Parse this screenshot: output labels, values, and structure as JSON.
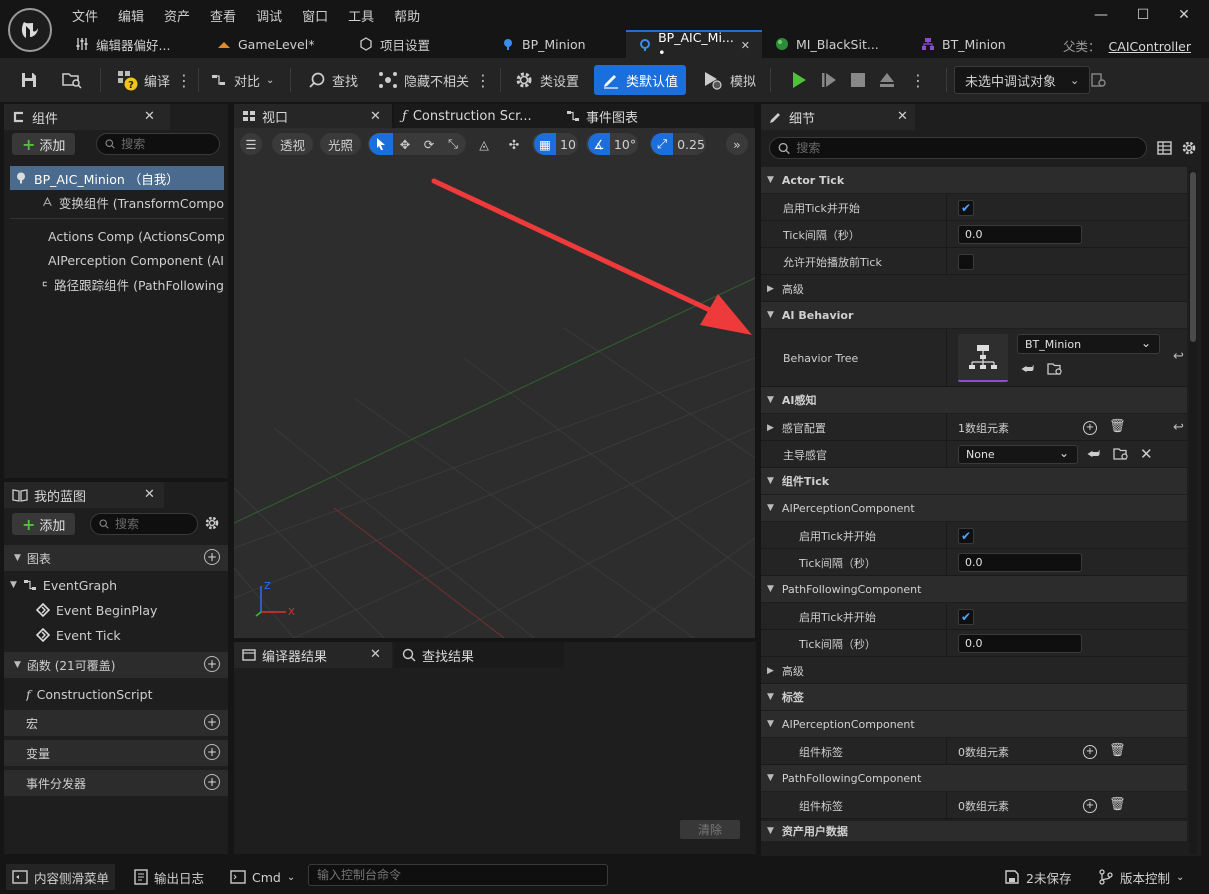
{
  "menu": [
    "文件",
    "编辑",
    "资产",
    "查看",
    "调试",
    "窗口",
    "工具",
    "帮助"
  ],
  "window_controls": {
    "minimize": "—",
    "maximize": "☐",
    "close": "✕"
  },
  "tabs": [
    {
      "label": "编辑器偏好...",
      "icon": "sliders-icon"
    },
    {
      "label": "GameLevel*",
      "icon": "level-icon"
    },
    {
      "label": "项目设置",
      "icon": "settings-icon"
    },
    {
      "label": "BP_Minion",
      "icon": "blueprint-icon"
    },
    {
      "label": "BP_AIC_Mi... •",
      "icon": "ai-controller-icon",
      "active": true,
      "close": "✕"
    },
    {
      "label": "MI_BlackSit...",
      "icon": "material-icon"
    },
    {
      "label": "BT_Minion",
      "icon": "behavior-tree-icon"
    }
  ],
  "parent": {
    "label": "父类：",
    "value": "CAIController"
  },
  "toolbar": {
    "compile": "编译",
    "diff": "对比",
    "find": "查找",
    "hide_unrelated": "隐藏不相关",
    "class_settings": "类设置",
    "class_defaults": "类默认值",
    "simulate": "模拟",
    "debug_target": "未选中调试对象"
  },
  "components_panel": {
    "title": "组件",
    "add": "添加",
    "search_placeholder": "搜索",
    "items": [
      "BP_AIC_Minion （自我）",
      "变换组件 (TransformCompo",
      "Actions Comp (ActionsComp",
      "AIPerception Component (AI",
      "路径跟踪组件 (PathFollowing"
    ]
  },
  "viewport": {
    "tab": "视口",
    "perspective": "透视",
    "lit": "光照",
    "grid_value": "10",
    "angle_value": "10°",
    "scale_value": "0.25"
  },
  "construction_tab": "Construction Scr...",
  "event_graph_tab": "事件图表",
  "my_blueprint": {
    "title": "我的蓝图",
    "add": "添加",
    "search_placeholder": "搜索",
    "graphs": "图表",
    "event_graph": "EventGraph",
    "event_begin_play": "Event BeginPlay",
    "event_tick": "Event Tick",
    "functions": "函数 (21可覆盖)",
    "construction_script": "ConstructionScript",
    "macros": "宏",
    "variables": "变量",
    "dispatchers": "事件分发器"
  },
  "compiler_results": {
    "tab": "编译器结果",
    "find_results": "查找结果",
    "clear": "清除"
  },
  "details": {
    "title": "细节",
    "search_placeholder": "搜索",
    "actor_tick": "Actor Tick",
    "start_with_tick": "启用Tick并开始",
    "tick_interval": "Tick间隔（秒）",
    "tick_interval_value": "0.0",
    "allow_tick_before_play": "允许开始播放前Tick",
    "advanced": "高级",
    "ai_behavior": "AI Behavior",
    "behavior_tree": "Behavior Tree",
    "behavior_tree_value": "BT_Minion",
    "ai_perception": "AI感知",
    "senses_config": "感官配置",
    "senses_config_value": "1数组元素",
    "dominant_sense": "主导感官",
    "dominant_sense_value": "None",
    "component_tick": "组件Tick",
    "ai_perception_component": "AIPerceptionComponent",
    "path_following_component": "PathFollowingComponent",
    "advanced2": "高级",
    "tags": "标签",
    "component_tags": "组件标签",
    "component_tags_value": "0数组元素",
    "asset_user_data": "资产用户数据"
  },
  "statusbar": {
    "content_drawer": "内容侧滑菜单",
    "output_log": "输出日志",
    "cmd": "Cmd",
    "console_placeholder": "输入控制台命令",
    "unsaved": "2未保存",
    "source_control": "版本控制"
  },
  "colors": {
    "accent": "#1b6fdc",
    "selection": "#4a6a8e",
    "play_green": "#4fc23a"
  }
}
